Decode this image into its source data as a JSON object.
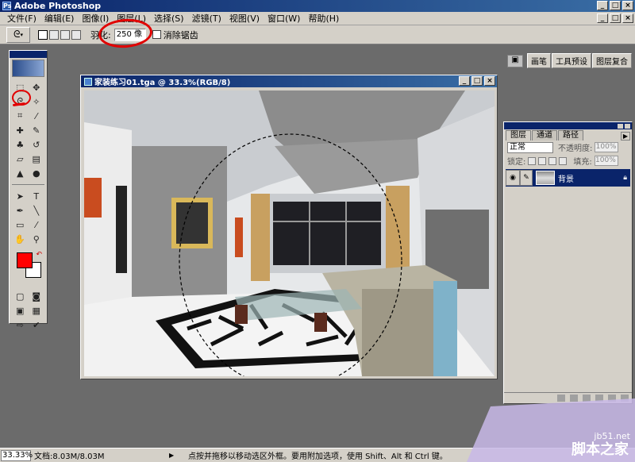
{
  "app": {
    "title": "Adobe Photoshop"
  },
  "menu": [
    "文件(F)",
    "编辑(E)",
    "图像(I)",
    "图层(L)",
    "选择(S)",
    "滤镜(T)",
    "视图(V)",
    "窗口(W)",
    "帮助(H)"
  ],
  "options": {
    "feather_label": "羽化:",
    "feather_value": "250 像",
    "antialias_label": "消除锯齿",
    "palette_tabs": [
      "画笔",
      "工具预设",
      "图层复合"
    ]
  },
  "document": {
    "title": "家装练习01.tga @ 33.3%(RGB/8)"
  },
  "layers": {
    "tabs": [
      "图层",
      "通道",
      "路径"
    ],
    "blend_mode": "正常",
    "opacity_label": "不透明度:",
    "opacity_value": "100%",
    "lock_label": "锁定:",
    "fill_label": "填充:",
    "fill_value": "100%",
    "items": [
      {
        "name": "背景"
      }
    ]
  },
  "status": {
    "zoom": "33.33%",
    "doc_size": "文档:8.03M/8.03M",
    "hint": "点按并拖移以移动选区外框。要用附加选项，使用 Shift、Alt 和 Ctrl 键。"
  },
  "watermark": {
    "url": "jb51.net",
    "name": "脚本之家"
  },
  "colors": {
    "foreground": "#ff0000",
    "background": "#ffffff",
    "annotation": "#e10000"
  }
}
